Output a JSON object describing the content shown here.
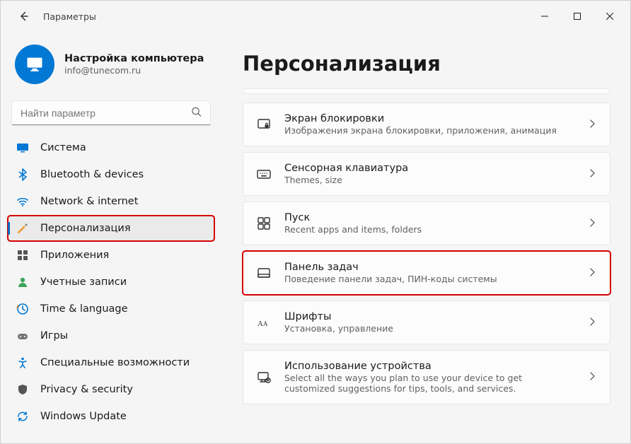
{
  "app_title": "Параметры",
  "profile": {
    "name": "Настройка компьютера",
    "email": "info@tunecom.ru"
  },
  "search": {
    "placeholder": "Найти параметр"
  },
  "sidebar": {
    "items": [
      {
        "label": "Система",
        "icon": "system"
      },
      {
        "label": "Bluetooth & devices",
        "icon": "bluetooth"
      },
      {
        "label": "Network & internet",
        "icon": "network"
      },
      {
        "label": "Персонализация",
        "icon": "personalization",
        "selected": true,
        "highlighted": true
      },
      {
        "label": "Приложения",
        "icon": "apps"
      },
      {
        "label": "Учетные записи",
        "icon": "accounts"
      },
      {
        "label": "Time & language",
        "icon": "time"
      },
      {
        "label": "Игры",
        "icon": "gaming"
      },
      {
        "label": "Специальные возможности",
        "icon": "accessibility"
      },
      {
        "label": "Privacy & security",
        "icon": "privacy"
      },
      {
        "label": "Windows Update",
        "icon": "update"
      }
    ]
  },
  "main": {
    "title": "Персонализация",
    "cards": [
      {
        "title": "Экран блокировки",
        "desc": "Изображения экрана блокировки, приложения, анимация",
        "icon": "lockscreen"
      },
      {
        "title": "Сенсорная клавиатура",
        "desc": "Themes, size",
        "icon": "keyboard"
      },
      {
        "title": "Пуск",
        "desc": "Recent apps and items, folders",
        "icon": "start"
      },
      {
        "title": "Панель задач",
        "desc": "Поведение панели задач, ПИН-коды системы",
        "icon": "taskbar",
        "highlighted": true
      },
      {
        "title": "Шрифты",
        "desc": "Установка, управление",
        "icon": "fonts"
      },
      {
        "title": "Использование устройства",
        "desc": "Select all the ways you plan to use your device to get customized suggestions for tips, tools, and services.",
        "icon": "usage"
      }
    ]
  }
}
